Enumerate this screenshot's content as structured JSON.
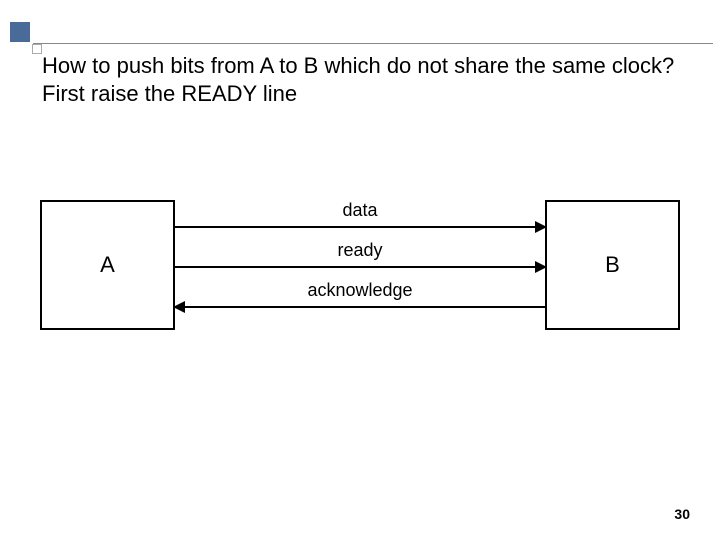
{
  "slide": {
    "title": "How to push bits from A to B which do not share the same clock? First raise the READY line",
    "page_number": "30"
  },
  "diagram": {
    "box_a": "A",
    "box_b": "B",
    "signals": {
      "data": "data",
      "ready": "ready",
      "acknowledge": "acknowledge"
    }
  }
}
